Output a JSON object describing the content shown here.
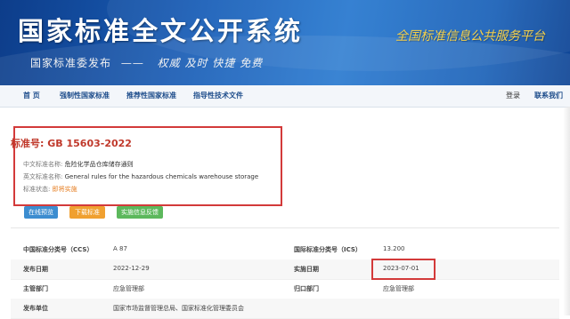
{
  "banner": {
    "title": "国家标准全文公开系统",
    "subtitle": "国家标准委发布",
    "subtitle_sep": "——",
    "mottos": "权威  及时  快捷  免费",
    "brand": "全国标准信息公共服务平台"
  },
  "nav": {
    "items": [
      "首 页",
      "强制性国家标准",
      "推荐性国家标准",
      "指导性技术文件",
      "联系我们"
    ],
    "login": "登录"
  },
  "standard": {
    "number_label": "标准号:",
    "number": "GB 15603-2022",
    "cn_name_label": "中文标准名称:",
    "cn_name": "危险化学品仓库储存通则",
    "en_name_label": "英文标准名称:",
    "en_name": "General rules for the hazardous chemicals warehouse storage",
    "status_label": "标准状态:",
    "status": "即将实施"
  },
  "buttons": {
    "preview": "在线预览",
    "download": "下载标准",
    "feedback": "实施信息反馈"
  },
  "details": {
    "ccs_label": "中国标准分类号（CCS）",
    "ccs_value": "A 87",
    "ics_label": "国际标准分类号（ICS）",
    "ics_value": "13.200",
    "publish_label": "发布日期",
    "publish_value": "2022-12-29",
    "implement_label": "实施日期",
    "implement_value": "2023-07-01",
    "authority_label": "主管部门",
    "authority_value": "应急管理部",
    "centralized_label": "归口部门",
    "centralized_value": "应急管理部",
    "issuer_label": "发布单位",
    "issuer_value": "国家市场监督管理总局、国家标准化管理委员会"
  },
  "colors": {
    "banner_blue": "#1a5fb8",
    "highlight_red": "#d33a3a",
    "std_no_red": "#c0392b",
    "status_orange": "#e67e22",
    "btn_preview": "#3c8dd0",
    "btn_download": "#f0a030",
    "btn_feedback": "#5cb85c",
    "nav_text": "#1f4e8c"
  }
}
